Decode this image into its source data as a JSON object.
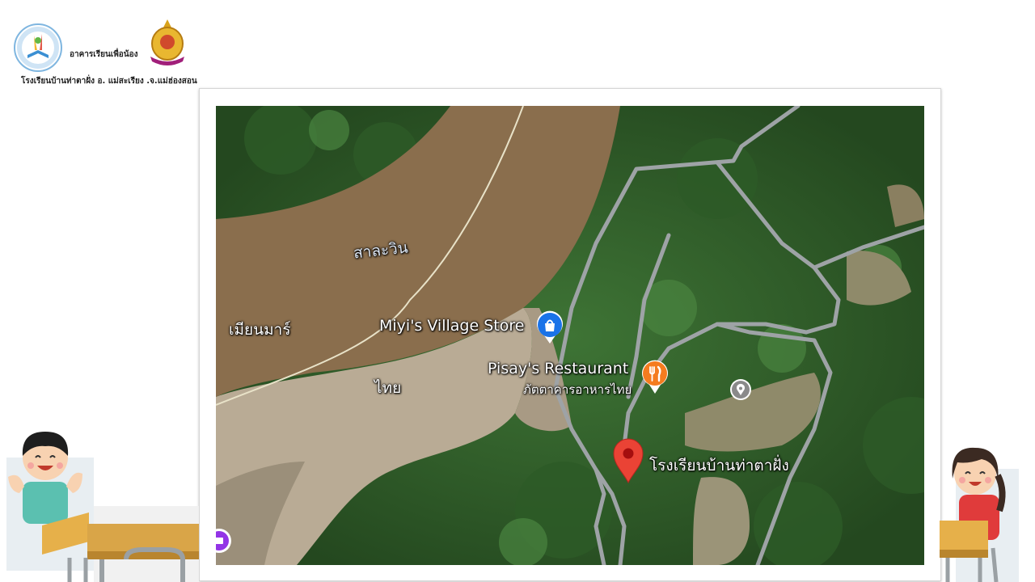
{
  "header": {
    "project_label": "อาคารเรียนเพื่อน้อง",
    "school_caption": "โรงเรียนบ้านท่าตาฝั่ง อ. แม่สะเรียง .จ.แม่ฮ่องสอน",
    "logo_left_icon": "foundation-logo-icon",
    "logo_right_icon": "royal-emblem-icon"
  },
  "map": {
    "river_label": "สาละวิน",
    "country_left": "เมียนมาร์",
    "country_right": "ไทย",
    "places": [
      {
        "name": "Miyi's Village Store",
        "subtitle": "",
        "icon": "shopping-bag-icon",
        "color": "#1a73e8"
      },
      {
        "name": "Pisay's Restaurant",
        "subtitle": "ภัตตาคารอาหารไทย",
        "icon": "fork-knife-icon",
        "color": "#f57c1f"
      },
      {
        "name": "",
        "subtitle": "",
        "icon": "place-pin-icon",
        "color": "#8a8a8a"
      },
      {
        "name": "โรงเรียนบ้านท่าตาฝั่ง",
        "subtitle": "",
        "icon": "red-location-pin-icon",
        "color": "#ea4335"
      },
      {
        "name": "",
        "subtitle": "",
        "icon": "purple-place-icon",
        "color": "#9334e6"
      }
    ]
  },
  "decor": {
    "left_illustration": "boy-at-desk-illustration",
    "right_illustration": "girl-at-desk-illustration"
  }
}
